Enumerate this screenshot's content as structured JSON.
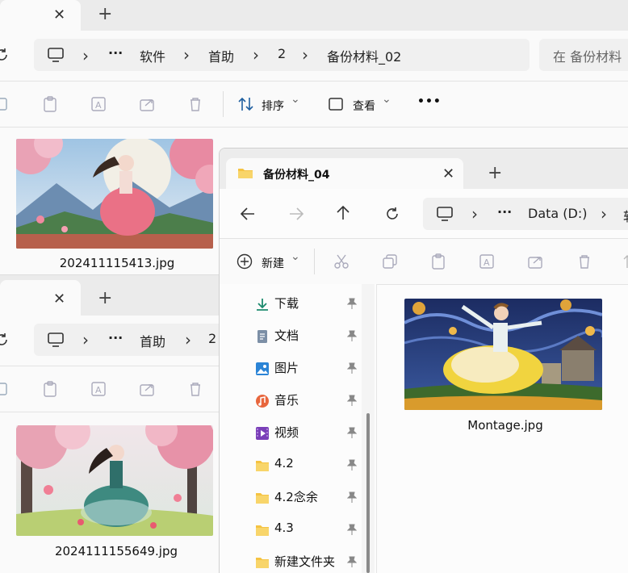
{
  "win1": {
    "address": {
      "items": [
        "软件",
        "首助",
        "2",
        "备份材料_02"
      ],
      "search_placeholder": "在 备份材料"
    },
    "toolbar": {
      "sort": "排序",
      "view": "查看",
      "more": "•••"
    },
    "file": "202411115413.jpg"
  },
  "win2": {
    "address": {
      "items": [
        "首助",
        "2"
      ]
    },
    "file": "2024111155649.jpg"
  },
  "win3": {
    "tab_title": "备份材料_04",
    "address": {
      "items": [
        "Data (D:)",
        "软"
      ]
    },
    "toolbar": {
      "new": "新建"
    },
    "nav": [
      {
        "label": "下载",
        "icon": "download-icon"
      },
      {
        "label": "文档",
        "icon": "document-icon"
      },
      {
        "label": "图片",
        "icon": "pictures-icon"
      },
      {
        "label": "音乐",
        "icon": "music-icon"
      },
      {
        "label": "视频",
        "icon": "video-icon"
      },
      {
        "label": "4.2",
        "icon": "folder-icon"
      },
      {
        "label": "4.2念余",
        "icon": "folder-icon"
      },
      {
        "label": "4.3",
        "icon": "folder-icon"
      },
      {
        "label": "新建文件夹",
        "icon": "folder-icon"
      }
    ],
    "file": "Montage.jpg"
  },
  "glyphs": {
    "close": "✕",
    "plus": "+",
    "ellipsis": "···",
    "chev": "›",
    "chev_down": "⌄"
  },
  "colors": {
    "folder": "#f5c342",
    "accent": "#0067c0"
  }
}
